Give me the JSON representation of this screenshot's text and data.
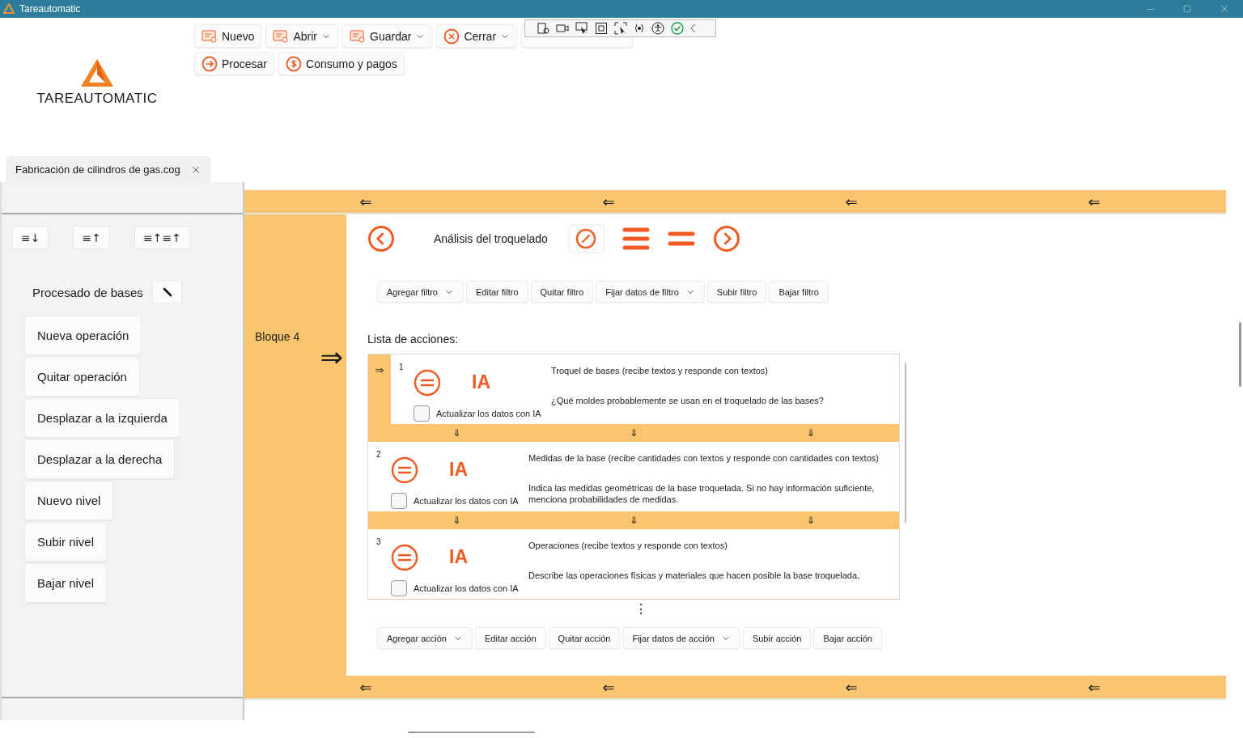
{
  "window": {
    "title": "Tareautomatic"
  },
  "logo": {
    "text": "TAREAUTOMATIC"
  },
  "toolbar": {
    "rows": [
      [
        {
          "label": "Nuevo",
          "kind": "document",
          "dropdown": false
        },
        {
          "label": "Abrir",
          "kind": "document",
          "dropdown": true
        },
        {
          "label": "Guardar",
          "kind": "document",
          "dropdown": true
        },
        {
          "label": "Cerrar",
          "kind": "cancel",
          "dropdown": true
        },
        {
          "dropdown": false
        }
      ],
      [
        {
          "label": "Procesar",
          "kind": "arrow",
          "dropdown": false
        },
        {
          "label": "Consumo y pagos",
          "kind": "coin",
          "dropdown": false
        }
      ]
    ]
  },
  "tabs": [
    {
      "label": "Fabricación de cilindros de gas.cog",
      "selected": true
    }
  ],
  "sidebar": {
    "sort_buttons": [
      "≡↓",
      "≡↑",
      "≡↑≡↑"
    ],
    "title": "Procesado de bases",
    "items": [
      "Nueva operación",
      "Quitar operación",
      "Desplazar a la izquierda",
      "Desplazar a la derecha",
      "Nuevo nivel",
      "Subir nivel",
      "Bajar nivel"
    ]
  },
  "block": {
    "label": "Bloque 4",
    "arrow": "⇒",
    "top_arrows": [
      "⇐",
      "⇐",
      "⇐",
      "⇐"
    ],
    "bottom_arrows": [
      "⇐",
      "⇐",
      "⇐",
      "⇐"
    ]
  },
  "operation": {
    "title": "Análisis del troquelado"
  },
  "filter_buttons": [
    {
      "label": "Agregar filtro",
      "dropdown": true
    },
    {
      "label": "Editar filtro",
      "dropdown": false
    },
    {
      "label": "Quitar filtro",
      "dropdown": false
    },
    {
      "label": "Fijar datos de filtro",
      "dropdown": true
    },
    {
      "label": "Subir filtro",
      "dropdown": false
    },
    {
      "label": "Bajar filtro",
      "dropdown": false
    }
  ],
  "actions": {
    "heading": "Lista de acciones:",
    "pointer": "⇒",
    "separator_arrows": [
      "⇓",
      "⇓",
      "⇓"
    ],
    "more": "⋮",
    "items": [
      {
        "number": "1",
        "current": true,
        "badge": "IA",
        "checkbox_label": "Actualizar los datos con IA",
        "checked": false,
        "title": "Troquel de bases (recibe textos y responde con textos)",
        "prompt": "¿Qué moldes probablemente se usan en el troquelado de las bases?"
      },
      {
        "number": "2",
        "current": false,
        "badge": "IA",
        "checkbox_label": "Actualizar los datos con IA",
        "checked": false,
        "title": "Medidas de la base (recibe cantidades con textos y responde con cantidades con textos)",
        "prompt": "Indica las medidas geométricas de la base troquelada. Si no hay información suficiente, menciona probabilidades de medidas."
      },
      {
        "number": "3",
        "current": false,
        "badge": "IA",
        "checkbox_label": "Actualizar los datos con IA",
        "checked": false,
        "title": "Operaciones (recibe textos y responde con textos)",
        "prompt": "Describe las operaciones físicas y materiales que hacen posible la base troquelada."
      }
    ]
  },
  "action_buttons": [
    {
      "label": "Agregar acción",
      "dropdown": true
    },
    {
      "label": "Editar acción",
      "dropdown": false
    },
    {
      "label": "Quitar acción",
      "dropdown": false
    },
    {
      "label": "Fijar datos de acción",
      "dropdown": true
    },
    {
      "label": "Subir acción",
      "dropdown": false
    },
    {
      "label": "Bajar acción",
      "dropdown": false
    }
  ]
}
